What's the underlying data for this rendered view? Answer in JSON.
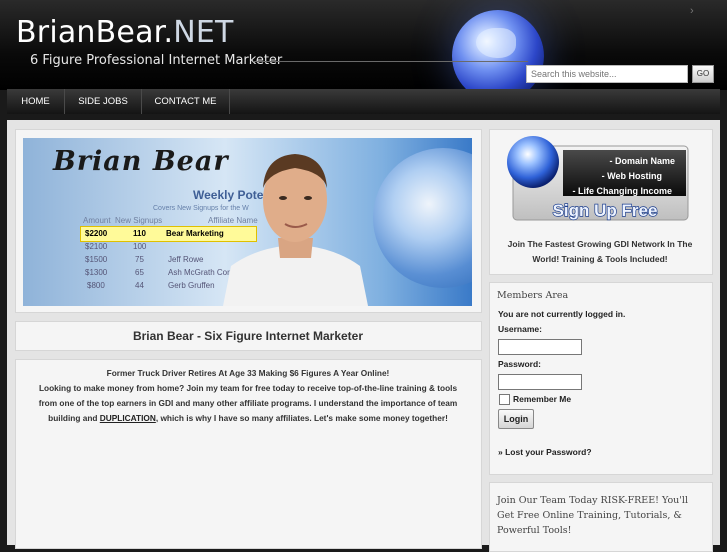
{
  "header": {
    "logo_main": "BrianBear.",
    "logo_net": "NET",
    "tagline": "6 Figure Professional Internet Marketer",
    "search_placeholder": "Search this website...",
    "search_button": "GO"
  },
  "nav": {
    "items": [
      {
        "label": "HOME"
      },
      {
        "label": "SIDE JOBS"
      },
      {
        "label": "CONTACT ME"
      }
    ]
  },
  "banner": {
    "name": "Brian Bear",
    "heading": "Weekly Poten",
    "subheading": "Covers New Signups for the W",
    "columns": [
      "Amount",
      "New Signups",
      "Affiliate Name"
    ],
    "rows": [
      [
        "$2200",
        "110",
        "Bear Marketing"
      ],
      [
        "$2100",
        "100",
        ""
      ],
      [
        "$1500",
        "75",
        "Jeff Rowe"
      ],
      [
        "$1300",
        "65",
        "Ash McGrath Corp"
      ],
      [
        "$800",
        "44",
        "Gerb Gruffen"
      ]
    ]
  },
  "main": {
    "post_title": "Brian Bear - Six Figure Internet Marketer",
    "desc_line1": "Former Truck Driver Retires At Age 33 Making $6 Figures A Year Online!",
    "desc_line2": "Looking to make money from home? Join my team for free today to receive top-of-the-line training & tools",
    "desc_line3": "from one of the top earners in GDI and many other affiliate programs. I understand the importance of team",
    "desc_line4_pre": "building and ",
    "desc_link": "DUPLICATION",
    "desc_line4_post": ", which is why I have so many affiliates. Let's make some money together!"
  },
  "sidebar": {
    "signup": {
      "bullets": [
        "- Domain Name",
        "- Web Hosting",
        "- Life Changing Income"
      ],
      "cta": "Sign Up Free"
    },
    "join_text": "Join The Fastest Growing GDI Network In The World! Training & Tools Included!",
    "members_title": "Members Area",
    "not_logged": "You are not currently logged in.",
    "username_label": "Username:",
    "password_label": "Password:",
    "remember_label": "Remember Me",
    "login_button": "Login",
    "lost_password": "» Lost your Password?",
    "join_risk": "Join Our Team Today RISK-FREE! You'll Get Free Online Training, Tutorials, & Powerful Tools!"
  }
}
